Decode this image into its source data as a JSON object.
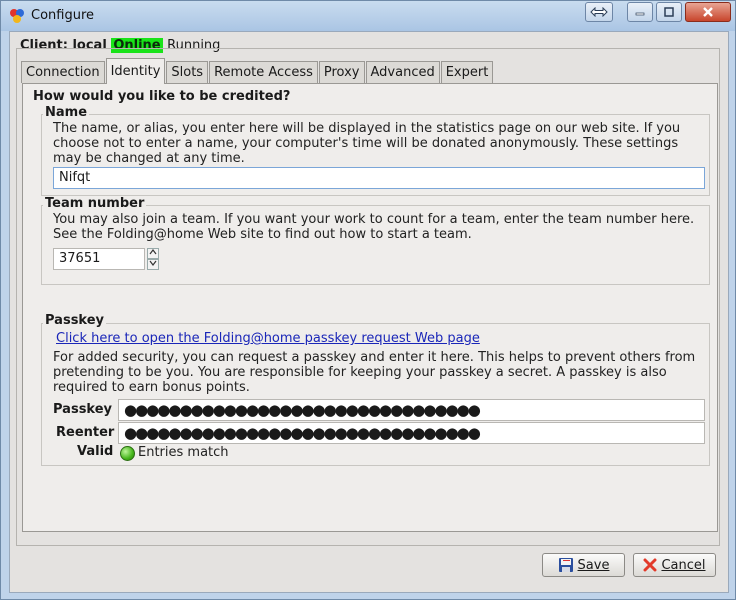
{
  "window": {
    "title": "Configure"
  },
  "status": {
    "prefix": "Client: local",
    "online": "Online",
    "running": "Running"
  },
  "tabs": [
    {
      "label": "Connection"
    },
    {
      "label": "Identity"
    },
    {
      "label": "Slots"
    },
    {
      "label": "Remote Access"
    },
    {
      "label": "Proxy"
    },
    {
      "label": "Advanced"
    },
    {
      "label": "Expert"
    }
  ],
  "identity": {
    "heading": "How would you like to be credited?",
    "name": {
      "legend": "Name",
      "desc_1": "The name, or alias, you enter here will be displayed in the statistics page on our web site.  If you",
      "desc_2": "choose not to enter a name, your computer's time will be donated anonymously.  These settings",
      "desc_3": "may be changed at any time.",
      "value": "Nifqt"
    },
    "team": {
      "legend": "Team number",
      "desc_1": "You may also join a team.  If you want your work to count for a team, enter the team number here.",
      "desc_2": "See the Folding@home Web site to find out how to start a team.",
      "value": "37651"
    },
    "passkey": {
      "legend": "Passkey",
      "link": "Click here to open the Folding@home passkey request Web page",
      "desc_1": "For added security, you can request a passkey and enter it here.  This helps to prevent others from",
      "desc_2": "pretending to be you.  You are responsible for keeping your passkey a secret.  A passkey is also",
      "desc_3": "required to earn bonus points.",
      "passkey_label": "Passkey",
      "passkey_value": "●●●●●●●●●●●●●●●●●●●●●●●●●●●●●●●●",
      "reenter_label": "Reenter",
      "reenter_value": "●●●●●●●●●●●●●●●●●●●●●●●●●●●●●●●●",
      "valid_label": "Valid",
      "valid_text": "Entries match",
      "valid_color": "#45b51b"
    }
  },
  "buttons": {
    "save": "Save",
    "cancel": "Cancel"
  }
}
